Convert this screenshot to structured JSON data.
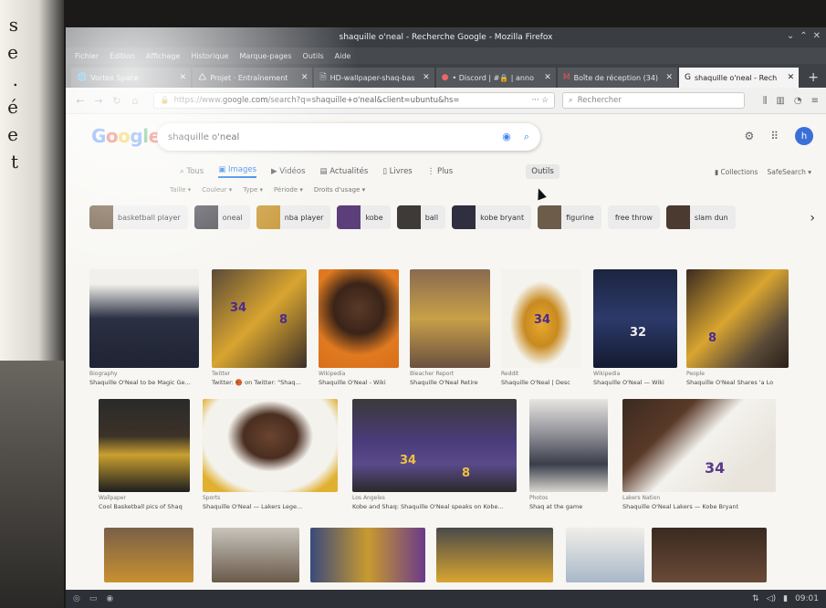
{
  "left_document": {
    "lines": [
      "s",
      "e",
      ".",
      "é",
      "e",
      "t"
    ]
  },
  "window": {
    "title": "shaquille o'neal - Recherche Google - Mozilla Firefox"
  },
  "menubar": [
    "Fichier",
    "Édition",
    "Affichage",
    "Historique",
    "Marque-pages",
    "Outils",
    "Aide"
  ],
  "tabs": [
    {
      "icon": "🌐",
      "label": "Vortex Space",
      "active": false
    },
    {
      "icon": "🛆",
      "label": "Projet · Entraînement",
      "active": false
    },
    {
      "icon": "🗎",
      "label": "HD-wallpaper-shaq-basket",
      "active": false
    },
    {
      "icon": "●",
      "label": "• Discord | #🔒 | anno",
      "active": false
    },
    {
      "icon": "M",
      "label": "Boîte de réception (34)",
      "active": false
    },
    {
      "icon": "G",
      "label": "shaquille o'neal - Rech",
      "active": true
    }
  ],
  "urlbar": {
    "prefix": "https://www.",
    "domain": "google.com",
    "rest": "/search?q=shaquille+o'neal&client=ubuntu&hs=",
    "actions": "··· ☆"
  },
  "browser_search": {
    "placeholder": "Rechercher"
  },
  "google": {
    "query": "shaquille o'neal",
    "avatar_letter": "h",
    "tabs": [
      "Tous",
      "Images",
      "Vidéos",
      "Actualités",
      "Livres",
      "Plus"
    ],
    "outils": "Outils",
    "collections": "Collections",
    "safesearch": "SafeSearch ▾",
    "filters": [
      "Taille ▾",
      "Couleur ▾",
      "Type ▾",
      "Période ▾",
      "Droits d'usage ▾"
    ],
    "chips": [
      "basketball player",
      "oneal",
      "nba player",
      "kobe",
      "ball",
      "kobe bryant",
      "figurine",
      "free throw",
      "slam dun"
    ]
  },
  "results_row1": [
    {
      "src": "Biography",
      "cap": "Shaquille O'Neal to be Magic Ge..."
    },
    {
      "src": "Twitter",
      "cap": "Twitter: 🏀 on Twitter: \"Shaq..."
    },
    {
      "src": "Wikipedia",
      "cap": "Shaquille O'Neal - Wiki"
    },
    {
      "src": "Bleacher Report",
      "cap": "Shaquille O'Neal Retire"
    },
    {
      "src": "Reddit",
      "cap": "Shaquille O'Neal | Desc"
    },
    {
      "src": "Wikipedia",
      "cap": "Shaquille O'Neal — Wiki"
    },
    {
      "src": "People",
      "cap": "Shaquille O'Neal Shares 'a Lo"
    }
  ],
  "results_row2": [
    {
      "src": "Wallpaper",
      "cap": "Cool Basketball pics of Shaq"
    },
    {
      "src": "Sports",
      "cap": "Shaquille O'Neal — Lakers Lege..."
    },
    {
      "src": "Los Angeles",
      "cap": "Kobe and Shaq: Shaquille O'Neal speaks on Kobe..."
    },
    {
      "src": "Photos",
      "cap": "Shaq at the game"
    },
    {
      "src": "Lakers Nation",
      "cap": "Shaquille O'Neal Lakers — Kobe Bryant"
    }
  ],
  "taskbar": {
    "time": "09:01"
  }
}
